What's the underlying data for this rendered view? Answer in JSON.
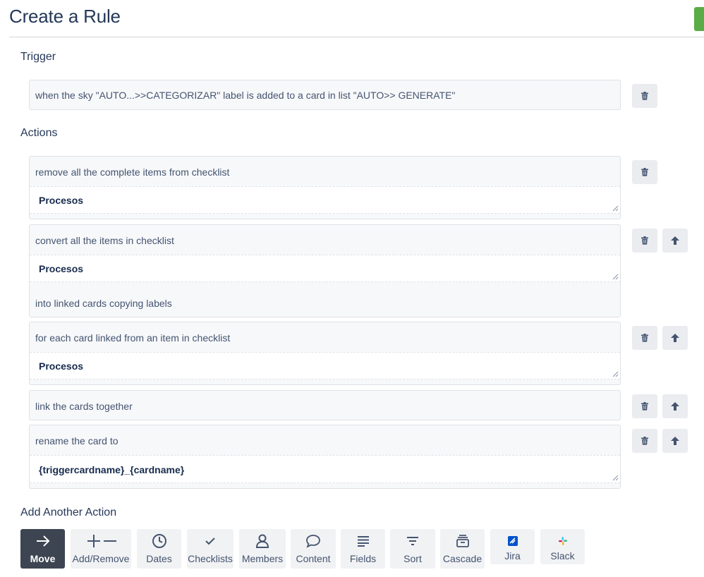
{
  "page": {
    "title": "Create a Rule"
  },
  "trigger": {
    "heading": "Trigger",
    "text": "when the sky \"AUTO...>>CATEGORIZAR\" label is added to a card in list \"AUTO>> GENERATE\""
  },
  "actions": {
    "heading": "Actions",
    "items": [
      {
        "text": "remove all the complete items from checklist",
        "field": "Procesos"
      },
      {
        "text": "convert all the items in checklist",
        "field": "Procesos",
        "suffix": "into linked cards copying labels"
      },
      {
        "text": "for each card linked from an item in checklist",
        "field": "Procesos"
      },
      {
        "text": "link the cards together"
      },
      {
        "text": "rename the card to",
        "field": "{triggercardname}_{cardname}"
      }
    ]
  },
  "add_action": {
    "heading": "Add Another Action",
    "tabs": [
      {
        "label": "Move",
        "icon": "arrow-right-icon",
        "active": true
      },
      {
        "label": "Add/Remove",
        "icon": "plus-minus-icon"
      },
      {
        "label": "Dates",
        "icon": "clock-icon"
      },
      {
        "label": "Checklists",
        "icon": "checkmark-icon"
      },
      {
        "label": "Members",
        "icon": "person-icon"
      },
      {
        "label": "Content",
        "icon": "speech-bubble-icon"
      },
      {
        "label": "Fields",
        "icon": "lines-icon"
      },
      {
        "label": "Sort",
        "icon": "filter-icon"
      },
      {
        "label": "Cascade",
        "icon": "stack-icon"
      },
      {
        "label": "Jira",
        "icon": "jira-icon"
      },
      {
        "label": "Slack",
        "icon": "slack-icon"
      }
    ]
  },
  "colors": {
    "accent_green": "#5aac44",
    "active_tile": "#3d4552",
    "button_gray": "#ebecf0",
    "jira_blue": "#0052cc"
  }
}
